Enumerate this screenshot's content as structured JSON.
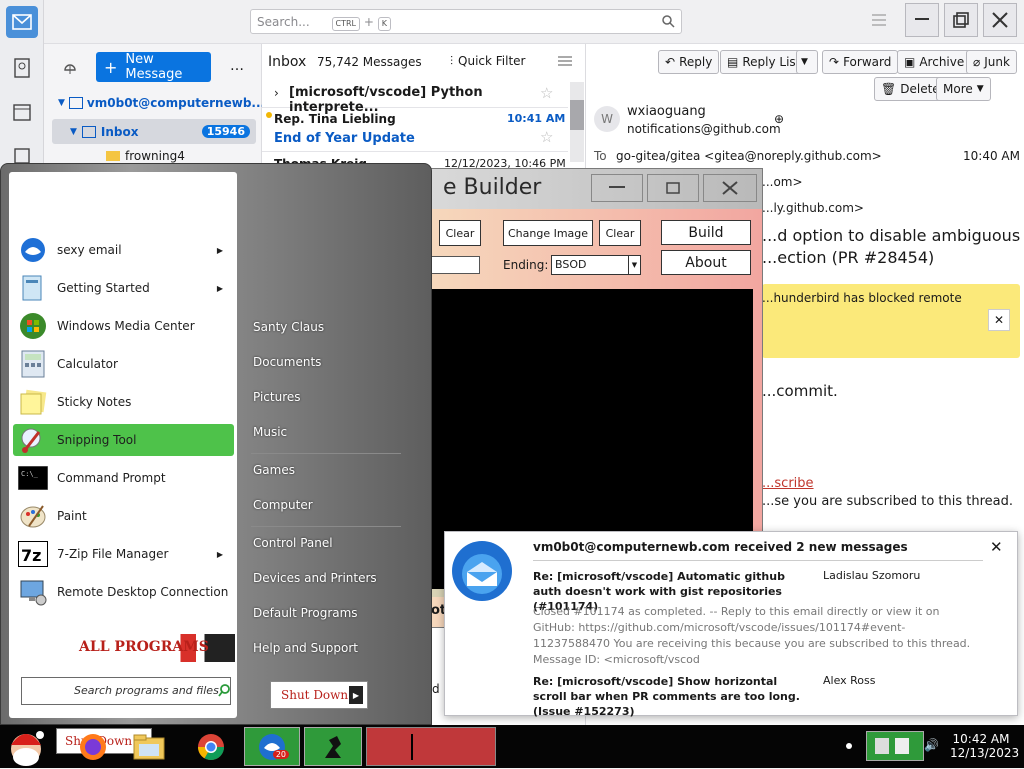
{
  "thunderbird": {
    "search": {
      "placeholder": "Search...",
      "kbd1": "CTRL",
      "plus": "+",
      "kbd2": "K"
    },
    "new_message": "New Message",
    "more_dots": "…",
    "account": "vm0b0t@computernewb...",
    "inbox": {
      "label": "Inbox",
      "count": "15946"
    },
    "folder": "frowning4",
    "thread_header": {
      "title": "Inbox",
      "count": "75,742 Messages",
      "quick_filter": "Quick Filter"
    },
    "threads": [
      {
        "subject": "[microsoft/vscode] Python interprete...",
        "sender": "",
        "time": ""
      },
      {
        "sender": "Rep. Tina Liebling",
        "time": "10:41 AM",
        "subject": "End of Year Update"
      },
      {
        "sender": "Thomas Kreig",
        "time": "12/12/2023, 10:46 PM",
        "subject": ""
      }
    ],
    "header_buttons": {
      "reply": "Reply",
      "reply_list": "Reply List",
      "forward": "Forward",
      "archive": "Archive",
      "junk": "Junk",
      "delete": "Delete",
      "more": "More"
    },
    "message": {
      "avatar": "W",
      "from_name": "wxiaoguang",
      "from_addr": "notifications@github.com",
      "to_label": "To",
      "to": "go-gitea/gitea <gitea@noreply.github.com>",
      "time": "10:40 AM",
      "to_line2": "...om>",
      "to_line3": "...ly.github.com>",
      "subject_part1": "...d option to disable ambiguous",
      "subject_part2": "...ection (PR #28454)",
      "banner": "...hunderbird has blocked remote",
      "body_commit": "...commit.",
      "body_link": "...scribe",
      "body_tail": "...se you are subscribed to this thread."
    }
  },
  "start_menu": {
    "programs": [
      {
        "label": "sexy email",
        "arrow": true
      },
      {
        "label": "Getting Started",
        "arrow": true
      },
      {
        "label": "Windows Media Center",
        "arrow": false
      },
      {
        "label": "Calculator",
        "arrow": false
      },
      {
        "label": "Sticky Notes",
        "arrow": false
      },
      {
        "label": "Snipping Tool",
        "arrow": false,
        "highlight": true
      },
      {
        "label": "Command Prompt",
        "arrow": false
      },
      {
        "label": "Paint",
        "arrow": false
      },
      {
        "label": "7-Zip File Manager",
        "arrow": true
      },
      {
        "label": "Remote Desktop Connection",
        "arrow": false
      }
    ],
    "all_programs": "ALL PROGRAMS",
    "search_placeholder": "Search programs and files",
    "right_items": [
      "Santy Claus",
      "Documents",
      "Pictures",
      "Music",
      "Games",
      "Computer",
      "Control Panel",
      "Devices and Printers",
      "Default Programs",
      "Help and Support"
    ],
    "shutdown": "Shut Down"
  },
  "builder": {
    "title": "e Builder",
    "clear1": "Clear",
    "change_image": "Change Image",
    "clear2": "Clear",
    "build": "Build",
    "about": "About",
    "ending_label": "Ending:",
    "ending_value": "BSOD",
    "partial1": "oti",
    "partial2": "d"
  },
  "notification": {
    "title": "vm0b0t@computernewb.com received 2 new messages",
    "msg1_subject": "Re: [microsoft/vscode] Automatic github auth doesn't work with gist repositories (#101174)",
    "msg1_sender": "Ladislau Szomoru",
    "msg1_preview": "Closed #101174 as completed. -- Reply to this email directly or view it on GitHub: https://github.com/microsoft/vscode/issues/101174#event-11237588470 You are receiving this because you are subscribed to this thread. Message ID: <microsoft/vscod",
    "msg2_subject": "Re: [microsoft/vscode] Show horizontal scroll bar when PR comments are too long. (Issue #152273)",
    "msg2_sender": "Alex Ross"
  },
  "taskbar": {
    "shutdown_label": "Shut Down",
    "badge": "20",
    "clock_time": "10:42 AM",
    "clock_date": "12/13/2023"
  }
}
